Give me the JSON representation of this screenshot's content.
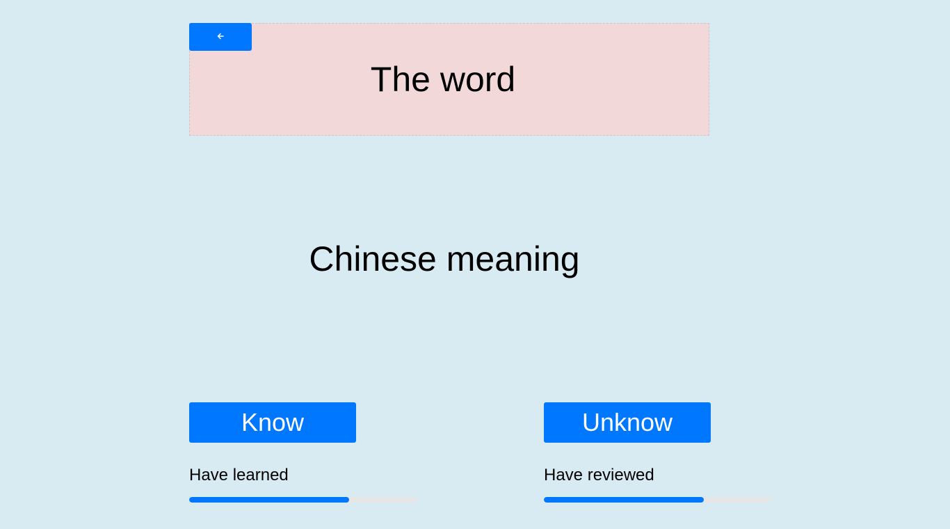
{
  "card": {
    "word": "The word",
    "meaning": "Chinese meaning"
  },
  "toolbar": {
    "back_icon": "arrow-left-icon"
  },
  "actions": {
    "know_label": "Know",
    "unknow_label": "Unknow"
  },
  "progress": {
    "learned_label": "Have learned",
    "learned_fraction": 0.7,
    "reviewed_label": "Have reviewed",
    "reviewed_fraction": 0.7
  },
  "colors": {
    "background": "#d8ebf2",
    "card": "#f2d8d8",
    "accent": "#0077ff",
    "track": "#e6e6e6"
  }
}
